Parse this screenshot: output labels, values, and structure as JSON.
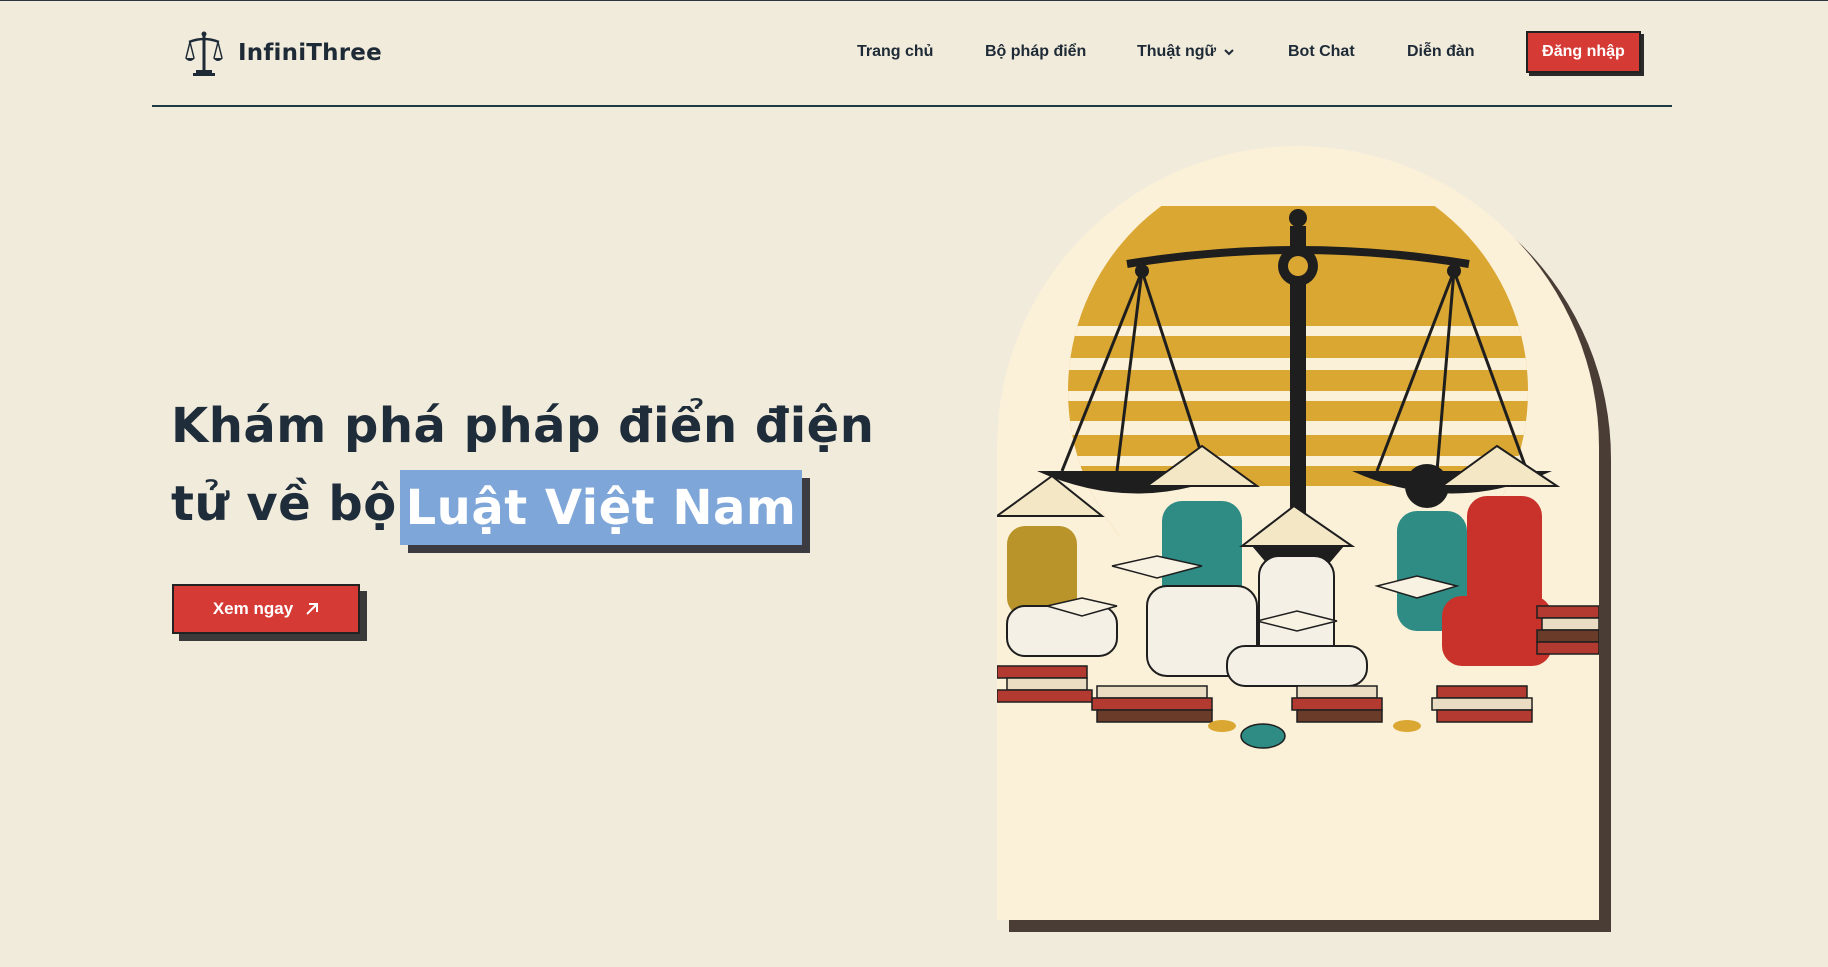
{
  "brand": {
    "name": "InfiniThree",
    "icon": "scales-icon"
  },
  "nav": {
    "items": [
      {
        "label": "Trang chủ"
      },
      {
        "label": "Bộ pháp điển"
      },
      {
        "label": "Thuật ngữ",
        "icon": "chevron-down-icon"
      },
      {
        "label": "Bot Chat"
      },
      {
        "label": "Diễn đàn"
      }
    ],
    "login_label": "Đăng nhập"
  },
  "hero": {
    "line1": "Khám phá pháp điển điện",
    "line2_prefix": "tử về bộ",
    "highlight": "Luật Việt Nam",
    "cta_label": "Xem ngay",
    "cta_icon": "arrow-up-right-icon"
  },
  "colors": {
    "accent_red": "#d63a35",
    "highlight_blue": "#7fa6d8",
    "text_dark": "#1e2a36",
    "background": "#f1ebdc"
  }
}
